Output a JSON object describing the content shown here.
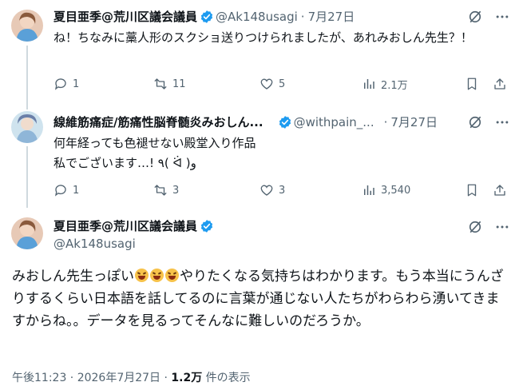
{
  "tweets": [
    {
      "name": "夏目亜季@荒川区議会議員",
      "handle": "@Ak148usagi",
      "time": "7月27日",
      "text": "ね！ちなみに藁人形のスクショ送りつけられましたが、あれみおしん先生？！",
      "replies": "1",
      "retweets": "11",
      "likes": "5",
      "views": "2.1万"
    },
    {
      "name": "線維筋痛症/筋痛性脳脊髄炎みおしん...",
      "handle": "@withpain_...",
      "time": "7月27日",
      "text_line1": "何年経っても色褪せない殿堂入り作品",
      "text_line2": "私でございます…! ٩( ᐛ )و",
      "replies": "1",
      "retweets": "3",
      "likes": "3",
      "views": "3,540"
    }
  ],
  "main": {
    "name": "夏目亜季@荒川区議会議員",
    "handle": "@Ak148usagi",
    "text_before_emoji": "みおしん先生っぽい",
    "text_after_emoji": "やりたくなる気持ちはわかります。もう本当にうんざりするくらい日本語を話してるのに言葉が通じない人たちがわらわら湧いてきますからね。。データを見るってそんなに難しいのだろうか。",
    "emoji_name": "rolling-on-the-floor-laughing",
    "posted_time": "午後11:23 · 2026年7月27日 · ",
    "views_count": "1.2万",
    "views_label": " 件の表示"
  },
  "colors": {
    "text": "#0f1419",
    "secondary": "#536471",
    "verified": "#1d9bf0",
    "line": "#cfd9de"
  }
}
